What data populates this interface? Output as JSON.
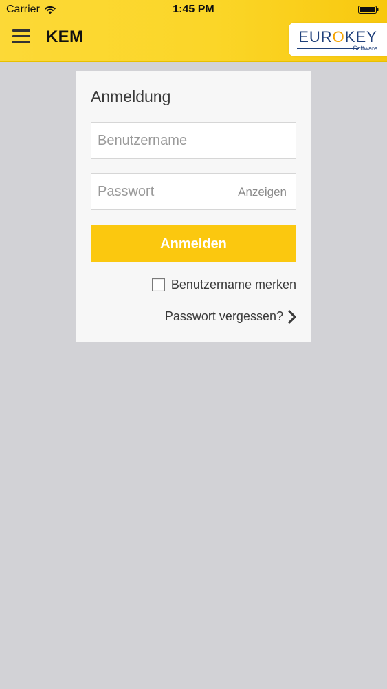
{
  "status_bar": {
    "carrier": "Carrier",
    "time": "1:45 PM"
  },
  "header": {
    "title": "KEM",
    "logo": {
      "part1": "EUR",
      "part_o": "O",
      "part2": "KEY",
      "subtitle": "Software"
    }
  },
  "login": {
    "title": "Anmeldung",
    "username_placeholder": "Benutzername",
    "username_value": "",
    "password_placeholder": "Passwort",
    "password_value": "",
    "show_password_label": "Anzeigen",
    "submit_label": "Anmelden",
    "remember_label": "Benutzername merken",
    "remember_checked": false,
    "forgot_label": "Passwort vergessen?"
  },
  "colors": {
    "header_yellow": "#fbd628",
    "button_yellow": "#fbc80f",
    "background": "#d2d2d6",
    "logo_blue": "#1e3f7a",
    "logo_orange": "#f5a300"
  },
  "icons": {
    "menu": "hamburger-menu-icon",
    "wifi": "wifi-icon",
    "battery": "battery-icon",
    "forgot": "chevron-right-icon"
  }
}
